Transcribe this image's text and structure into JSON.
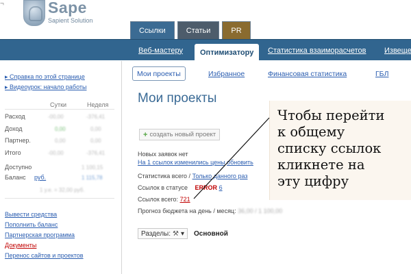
{
  "header": {
    "brand": "Sape",
    "tagline": "Sapient Solution",
    "corner_mark": "¬"
  },
  "top_tabs": [
    {
      "label": "Ссылки"
    },
    {
      "label": "Статьи"
    },
    {
      "label": "PR"
    }
  ],
  "nav": {
    "items": [
      {
        "label": "Веб-мастеру"
      },
      {
        "label": "Оптимизатору"
      },
      {
        "label": "Статистика взаиморасчетов"
      },
      {
        "label": "Извеще"
      }
    ]
  },
  "sidebar": {
    "help_link": "Справка по этой странице",
    "video_link": "Видеоурок: начало работы",
    "col_day": "Сутки",
    "col_week": "Неделя",
    "rows": [
      {
        "label": "Расход",
        "day": "-00,00",
        "week": "-376,41"
      },
      {
        "label": "Доход",
        "day": "0,00",
        "week": "0,00"
      },
      {
        "label": "Партнер.",
        "day": "0,00",
        "week": "0,00"
      },
      {
        "label": "Итого",
        "day": "-00,00",
        "week": "-376,41"
      }
    ],
    "available_label": "Доступно",
    "available_value": "1 100,15",
    "balance_label": "Баланс",
    "balance_currency": "руб.",
    "balance_value": "1 115,78",
    "rate_value": "1 у.е. = 32,00  руб.",
    "bottom_links": [
      {
        "label": "Вывести средства"
      },
      {
        "label": "Пополнить баланс"
      },
      {
        "label": "Партнерская программа"
      },
      {
        "label": "Документы"
      },
      {
        "label": "Перенос сайтов и проектов"
      }
    ]
  },
  "main": {
    "subtabs": [
      {
        "label": "Мои проекты"
      },
      {
        "label": "Избранное"
      },
      {
        "label": "Финансовая статистика"
      },
      {
        "label": "ГБЛ"
      }
    ],
    "title": "Мои проекты",
    "new_project": "создать новый проект",
    "no_new": "Новых заявок нет",
    "prices_prefix": "На 1 ссылок изменились цены",
    "prices_action": "обновить",
    "stats_label": "Статистика всего /",
    "stats_link": "Только данного раз",
    "status_label": "Ссылок в статусе",
    "status_code": "ERROR",
    "status_count": "6",
    "total_label": "Ссылок всего:",
    "total_count": "721",
    "budget_label": "Прогноз бюджета на день / месяц:",
    "budget_value": "36,00 / 1 100,00",
    "sections_label": "Разделы:",
    "sections_icon": "wrench-icon",
    "osnovnoy": "Основной"
  },
  "callout": {
    "lines": [
      "Чтобы перейти",
      "к общему",
      "списку ссылок",
      "кликнете на",
      "эту цифру"
    ]
  },
  "colors": {
    "nav_bg": "#31658f",
    "link": "#2a5db0",
    "error": "#c00000",
    "title": "#3a6a95",
    "callout_bg": "#fbf6ef"
  }
}
